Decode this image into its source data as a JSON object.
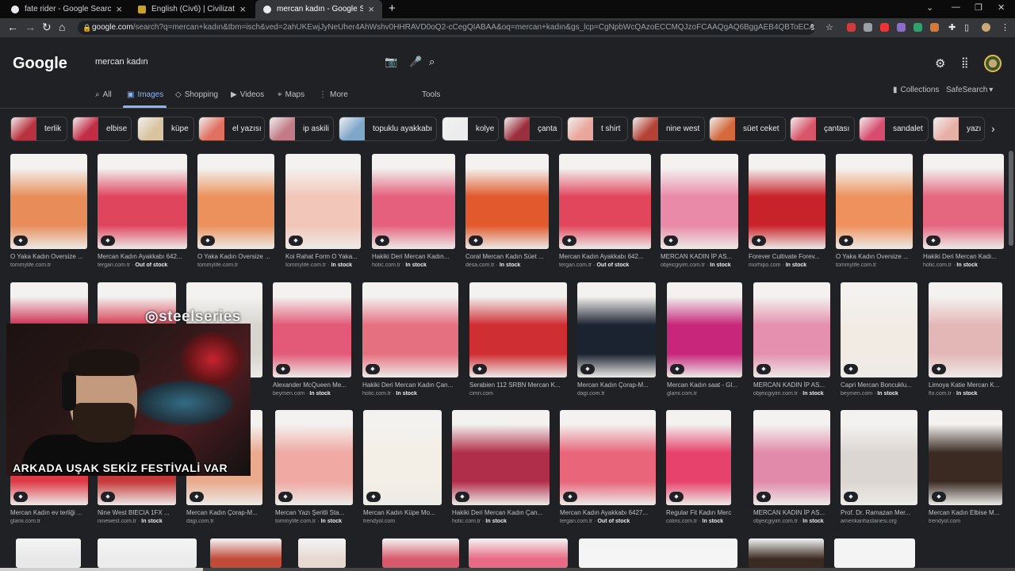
{
  "browser": {
    "tabs": [
      {
        "title": "fate rider - Google Search",
        "active": false
      },
      {
        "title": "English (Civ6) | Civilization Wiki |",
        "active": false
      },
      {
        "title": "mercan kadın - Google Search",
        "active": true
      }
    ],
    "url_host": "google.com",
    "url_path": "/search?q=mercan+kadın&tbm=isch&ved=2ahUKEwjJyNeUher4AhWshv0HHRAVD0oQ2-cCegQIABAA&oq=mercan+kadın&gs_lcp=CgNpbWcQAzoECCMQJzoFCAAQgAQ6BggAEB4QBToECAAQHjoGCAAQ..."
  },
  "google": {
    "logo": "Google",
    "query": "mercan kadın",
    "nav_tabs": [
      {
        "label": "All",
        "icon": "search-icon"
      },
      {
        "label": "Images",
        "icon": "image-icon"
      },
      {
        "label": "Shopping",
        "icon": "tag-icon"
      },
      {
        "label": "Videos",
        "icon": "play-icon"
      },
      {
        "label": "Maps",
        "icon": "map-pin-icon"
      },
      {
        "label": "More",
        "icon": "more-icon"
      }
    ],
    "tools": "Tools",
    "collections": "Collections",
    "safesearch": "SafeSearch"
  },
  "chips": [
    {
      "label": "terlik",
      "color": "#b9323f"
    },
    {
      "label": "elbise",
      "color": "#c22c45"
    },
    {
      "label": "küpe",
      "color": "#d9c3a0"
    },
    {
      "label": "el yazısı",
      "color": "#e07060"
    },
    {
      "label": "ip askili",
      "color": "#c27b86"
    },
    {
      "label": "topuklu ayakkabı",
      "color": "#7fa7c9"
    },
    {
      "label": "kolye",
      "color": "#ececec"
    },
    {
      "label": "çanta",
      "color": "#9c2f3e"
    },
    {
      "label": "t shirt",
      "color": "#e9a79c"
    },
    {
      "label": "nine west",
      "color": "#b44335"
    },
    {
      "label": "süet ceket",
      "color": "#d46a3c"
    },
    {
      "label": "çantası",
      "color": "#d9566a"
    },
    {
      "label": "sandalet",
      "color": "#d84d6f"
    },
    {
      "label": "yazı",
      "color": "#e7b0a7"
    }
  ],
  "row1": [
    {
      "title": "O Yaka Kadın Oversize ...",
      "source": "tommylife.com.tr",
      "stock": "",
      "color": "#e88d59"
    },
    {
      "title": "Mercan Kadın Ayakkabı 642...",
      "source": "tergan.com.tr",
      "stock": "Out of stock",
      "color": "#e0455e"
    },
    {
      "title": "O Yaka Kadın Oversize ...",
      "source": "tommylife.com.tr",
      "stock": "",
      "color": "#ec915b"
    },
    {
      "title": "Koi Rahat Form O Yaka...",
      "source": "tommylife.com.tr",
      "stock": "In stock",
      "color": "#f2c6b8"
    },
    {
      "title": "Hakiki Deri Mercan Kadın...",
      "source": "hotic.com.tr",
      "stock": "In stock",
      "color": "#e5607c"
    },
    {
      "title": "Coral Mercan Kadın Süet ...",
      "source": "desa.com.tr",
      "stock": "In stock",
      "color": "#e1592c"
    },
    {
      "title": "Mercan Kadın Ayakkabı 642...",
      "source": "tergan.com.tr",
      "stock": "Out of stock",
      "color": "#e2465d"
    },
    {
      "title": "MERCAN KADIN İP AS...",
      "source": "objeicgiyim.com.tr",
      "stock": "In stock",
      "color": "#e98aa8"
    },
    {
      "title": "Forever Cultivate Forev...",
      "source": "morhipo.com",
      "stock": "In stock",
      "color": "#c8232a"
    },
    {
      "title": "O Yaka Kadın Oversize ...",
      "source": "tommylife.com.tr",
      "stock": "",
      "color": "#ee915c"
    },
    {
      "title": "Hakiki Deri Mercan Kadı...",
      "source": "hotic.com.tr",
      "stock": "In stock",
      "color": "#e4667f"
    }
  ],
  "row2": [
    {
      "title": "",
      "source": "",
      "stock": "",
      "color": "#cf2c4f"
    },
    {
      "title": "",
      "source": "",
      "stock": "",
      "color": "#d73a4f"
    },
    {
      "title": "",
      "source": "",
      "stock": "",
      "color": "#d8d5d0"
    },
    {
      "title": "Alexander McQueen Me...",
      "source": "beymen.com",
      "stock": "In stock",
      "color": "#e25a78"
    },
    {
      "title": "Hakiki Deri Mercan Kadın Çan...",
      "source": "hotic.com.tr",
      "stock": "In stock",
      "color": "#e5707f"
    },
    {
      "title": "Serabien 112 SRBN Mercan K...",
      "source": "cimri.com",
      "stock": "",
      "color": "#cf2e33"
    },
    {
      "title": "Mercan Kadın Çorap-M...",
      "source": "dagi.com.tr",
      "stock": "",
      "color": "#1b2230"
    },
    {
      "title": "Mercan Kadın saat - Gl...",
      "source": "glami.com.tr",
      "stock": "",
      "color": "#c7267a"
    },
    {
      "title": "MERCAN KADIN İP AS...",
      "source": "objeicgiyim.com.tr",
      "stock": "In stock",
      "color": "#e490ae"
    },
    {
      "title": "Capri Mercan Boncuklu...",
      "source": "beymen.com",
      "stock": "In stock",
      "color": "#f2ebe4"
    },
    {
      "title": "Limoya Katie Mercan K...",
      "source": "flo.com.tr",
      "stock": "In stock",
      "color": "#e4b7b7"
    }
  ],
  "row3": [
    {
      "title": "Mercan Kadın ev terliği ...",
      "source": "glami.com.tr",
      "stock": "",
      "color": "#de3a46"
    },
    {
      "title": "Nine West BIECIA 1FX ...",
      "source": "ninewest.com.tr",
      "stock": "In stock",
      "color": "#c53a3a"
    },
    {
      "title": "Mercan Kadın Çorap-M...",
      "source": "dagi.com.tr",
      "stock": "",
      "color": "#e9aa8e"
    },
    {
      "title": "Mercan Yazı Şeritli Sta...",
      "source": "tommylife.com.tr",
      "stock": "In stock",
      "color": "#f0a9a3"
    },
    {
      "title": "Mercan Kadın Küpe Mo...",
      "source": "trendyol.com",
      "stock": "",
      "color": "#f4efe6"
    },
    {
      "title": "Hakiki Deri Mercan Kadın Çan...",
      "source": "hotic.com.tr",
      "stock": "In stock",
      "color": "#b12e4a"
    },
    {
      "title": "Mercan Kadın Ayakkabı 6427...",
      "source": "tergan.com.tr",
      "stock": "Out of stock",
      "color": "#e8657a"
    },
    {
      "title": "Regular Fit Kadın Merc...",
      "source": "colins.com.tr",
      "stock": "In stock",
      "color": "#e7426b"
    },
    {
      "title": "MERCAN KADIN İP AS...",
      "source": "objeicgiyim.com.tr",
      "stock": "In stock",
      "color": "#e18aaa"
    },
    {
      "title": "Prof. Dr. Ramazan Mer...",
      "source": "amerikanhastanesi.org",
      "stock": "",
      "color": "#dcd6d2"
    },
    {
      "title": "Mercan Kadın Elbise M...",
      "source": "trendyol.com",
      "stock": "",
      "color": "#3a2a22"
    }
  ],
  "row4_colors": [
    "#e8e8e8",
    "#ececec",
    "#c24a38",
    "#e6d9d2",
    "#d75a6c",
    "#e96a84",
    "#f5f5f5",
    "#3b2a22",
    "#f4f4f4"
  ],
  "stream": {
    "watermark": "steelseries",
    "caption": "ARKADA UŞAK SEKİZ FESTİVALİ VAR"
  },
  "video_progress": 0.2
}
